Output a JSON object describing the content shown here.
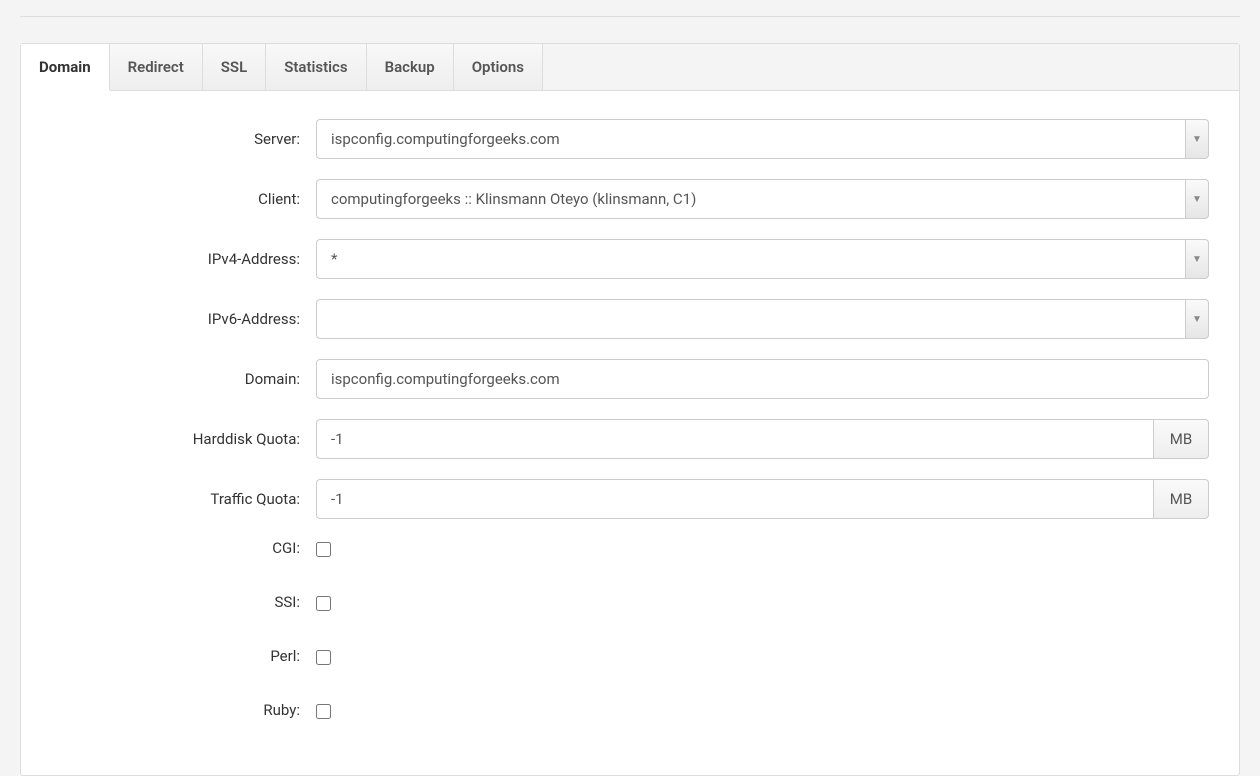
{
  "tabs": [
    {
      "label": "Domain",
      "active": true
    },
    {
      "label": "Redirect",
      "active": false
    },
    {
      "label": "SSL",
      "active": false
    },
    {
      "label": "Statistics",
      "active": false
    },
    {
      "label": "Backup",
      "active": false
    },
    {
      "label": "Options",
      "active": false
    }
  ],
  "labels": {
    "server": "Server:",
    "client": "Client:",
    "ipv4": "IPv4-Address:",
    "ipv6": "IPv6-Address:",
    "domain": "Domain:",
    "hdquota": "Harddisk Quota:",
    "trafficquota": "Traffic Quota:",
    "cgi": "CGI:",
    "ssi": "SSI:",
    "perl": "Perl:",
    "ruby": "Ruby:"
  },
  "values": {
    "server": "ispconfig.computingforgeeks.com",
    "client": "computingforgeeks :: Klinsmann Oteyo (klinsmann, C1)",
    "ipv4": "*",
    "ipv6": "",
    "domain": "ispconfig.computingforgeeks.com",
    "hdquota": "-1",
    "trafficquota": "-1",
    "cgi": false,
    "ssi": false,
    "perl": false,
    "ruby": false
  },
  "units": {
    "mb": "MB"
  }
}
